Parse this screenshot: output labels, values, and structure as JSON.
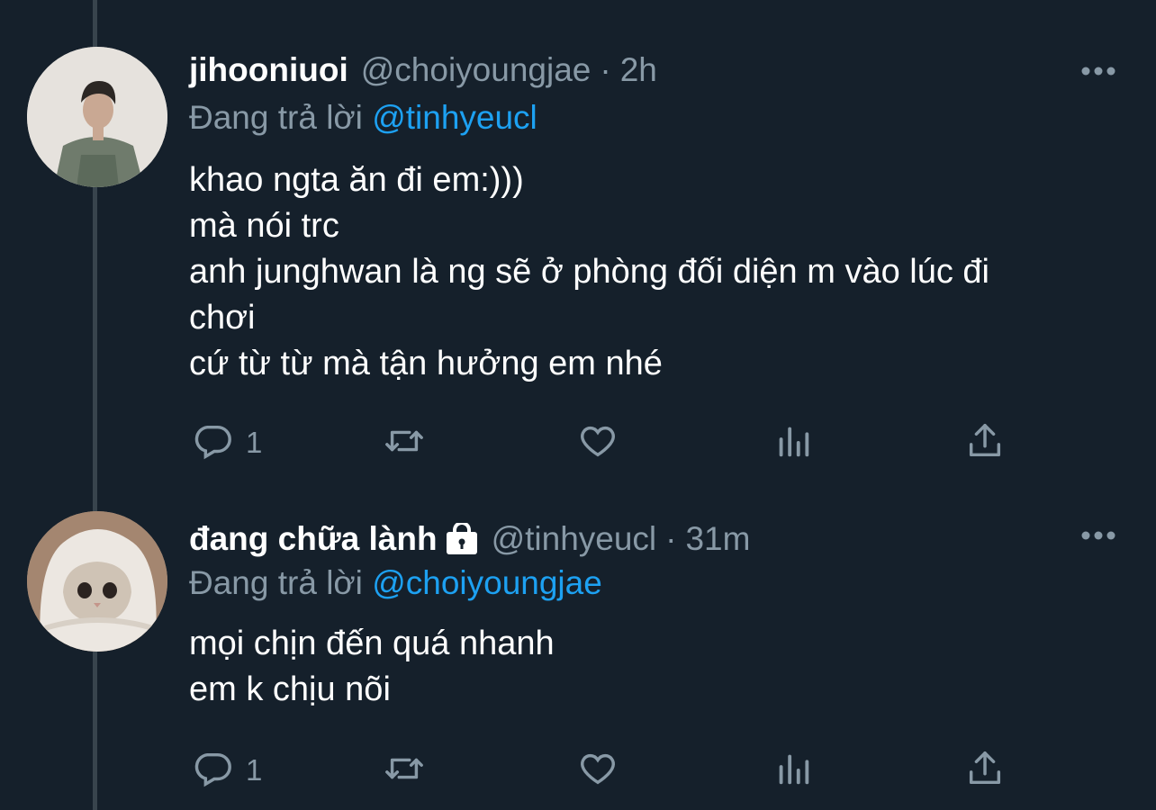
{
  "tweets": [
    {
      "display_name": "jihooniuoi",
      "handle": "@choiyoungjae",
      "separator": "·",
      "time": "2h",
      "replying_prefix": "Đang trả lời",
      "replying_to": "@tinhyeucl",
      "lines": [
        "khao ngta ăn đi em:)))",
        "mà nói trc",
        "anh junghwan là ng sẽ ở phòng đối diện m vào lúc đi",
        "chơi",
        "cứ từ từ mà tận hưởng em nhé"
      ],
      "reply_count": "1",
      "locked": false
    },
    {
      "display_name": "đang chữa lành",
      "handle": "@tinhyeucl",
      "separator": "·",
      "time": "31m",
      "replying_prefix": "Đang trả lời",
      "replying_to": "@choiyoungjae",
      "lines": [
        "mọi chịn đến quá nhanh",
        "em k chịu nõi"
      ],
      "reply_count": "1",
      "locked": true
    }
  ],
  "colors": {
    "background": "#15202b",
    "text": "#ffffff",
    "secondary": "#8899a6",
    "accent": "#1da1f2",
    "thread_line": "#38444d"
  },
  "icons": [
    "reply-icon",
    "retweet-icon",
    "like-icon",
    "analytics-icon",
    "share-icon",
    "more-icon",
    "lock-icon"
  ]
}
